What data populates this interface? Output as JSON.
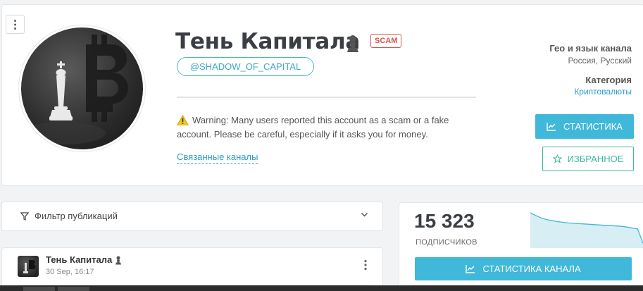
{
  "header": {
    "menu_glyph": "⋮",
    "title": "Тень Капитала",
    "scam_badge": "SCAM",
    "handle": "@SHADOW_OF_CAPITAL",
    "warning": "Warning: Many users reported this account as a scam or a fake account. Please be careful, especially if it asks you for money.",
    "related_link": "Связанные каналы",
    "geo_label": "Гео и язык канала",
    "geo_value": "Россия, Русский",
    "category_label": "Категория",
    "category_value": "Криптовалюты",
    "stats_button": "СТАТИСТИКА",
    "favorite_button": "ИЗБРАННОЕ"
  },
  "filter": {
    "label": "Фильтр публикаций"
  },
  "post": {
    "author": "Тень Капитала",
    "date": "30 Sep, 16:17"
  },
  "stats": {
    "subscribers": "15 323",
    "subscribers_label": "ПОДПИСЧИКОВ",
    "channel_stats_button": "СТАТИСТИКА КАНАЛА",
    "sparkline_values": [
      100,
      92,
      85,
      80,
      77,
      74,
      72,
      70,
      69,
      68,
      67,
      66,
      65,
      64,
      63,
      62,
      61,
      60,
      58,
      55,
      52,
      10
    ]
  },
  "colors": {
    "accent": "#3fb8d9",
    "favorite": "#3fb8a0",
    "scam": "#d9534f",
    "warning": "#f0c419",
    "link": "#2d9cc5"
  },
  "icons": {
    "pawn": "user-pawn-icon",
    "warning": "warning-triangle-icon",
    "chart": "line-chart-icon",
    "star": "star-icon",
    "filter": "filter-funnel-icon",
    "chevron": "chevron-down-icon",
    "kebab": "kebab-menu-icon"
  }
}
